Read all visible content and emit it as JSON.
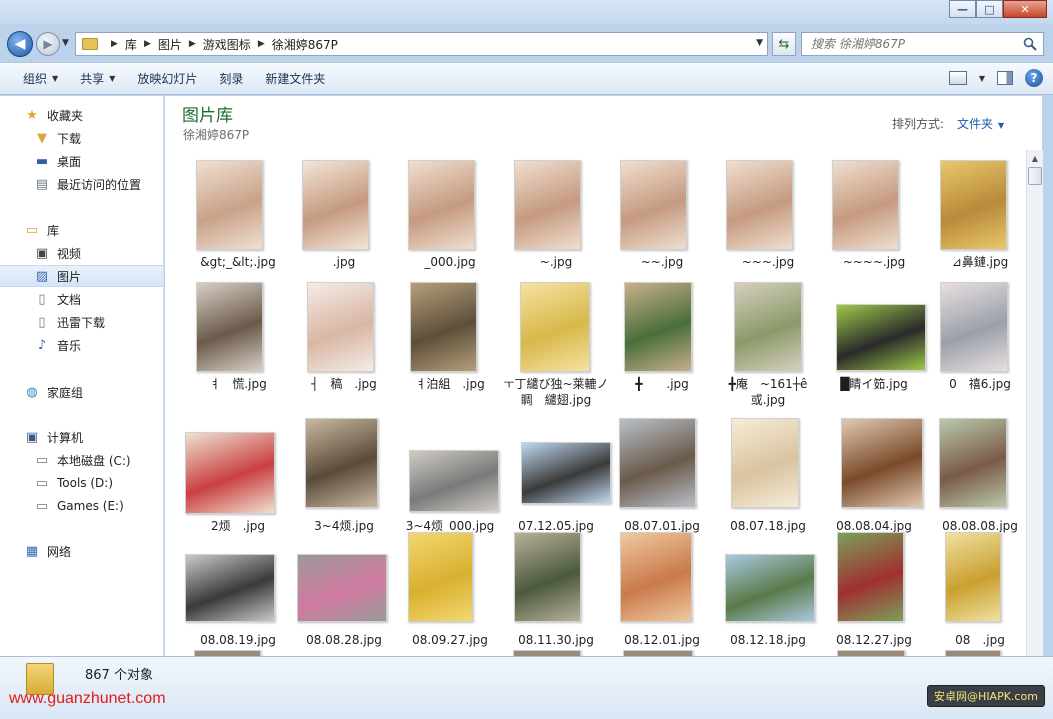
{
  "window": {
    "controls": [
      "—",
      "□",
      "✕"
    ]
  },
  "address": {
    "crumbs": [
      "库",
      "图片",
      "游戏图标",
      "徐湘婷867P"
    ]
  },
  "search": {
    "placeholder": "搜索 徐湘婷867P"
  },
  "toolbar": {
    "organize": "组织",
    "share": "共享",
    "slideshow": "放映幻灯片",
    "burn": "刻录",
    "new_folder": "新建文件夹"
  },
  "navpane": {
    "favorites": "收藏夹",
    "downloads": "下载",
    "desktop": "桌面",
    "recent": "最近访问的位置",
    "libraries": "库",
    "videos": "视频",
    "pictures": "图片",
    "documents": "文档",
    "xunlei": "迅雷下载",
    "music": "音乐",
    "homegroup": "家庭组",
    "computer": "计算机",
    "drive_c": "本地磁盘 (C:)",
    "drive_d": "Tools (D:)",
    "drive_e": "Games (E:)",
    "network": "网络"
  },
  "content": {
    "title": "图片库",
    "subtitle": "徐湘婷867P",
    "arrange_label": "排列方式:",
    "arrange_value": "文件夹"
  },
  "files": [
    {
      "name": "&gt;_&lt;.jpg",
      "colors": [
        "#c9a189",
        "#efe0d2"
      ]
    },
    {
      "name": ".jpg",
      "colors": [
        "#c59a80",
        "#f3e5d8"
      ]
    },
    {
      "name": "_000.jpg",
      "colors": [
        "#c59a80",
        "#efdfd0"
      ]
    },
    {
      "name": "~.jpg",
      "colors": [
        "#c59a80",
        "#efdfd0"
      ]
    },
    {
      "name": "~~.jpg",
      "colors": [
        "#c59a80",
        "#efdfd0"
      ]
    },
    {
      "name": "~~~.jpg",
      "colors": [
        "#c59a80",
        "#efdfd0"
      ]
    },
    {
      "name": "~~~~.jpg",
      "colors": [
        "#c59a80",
        "#efdfd0"
      ]
    },
    {
      "name": "⊿鼻鏈.jpg",
      "colors": [
        "#b88a3a",
        "#e9c86a"
      ]
    },
    {
      "name": "ㅕ　慌.jpg",
      "colors": [
        "#6b5a4a",
        "#d7cfc5"
      ]
    },
    {
      "name": "┤　稿　.jpg",
      "colors": [
        "#d9b6a3",
        "#f4ece6"
      ]
    },
    {
      "name": "ㅕ泊組　.jpg",
      "colors": [
        "#5d4f3b",
        "#b59f7a"
      ]
    },
    {
      "name": "ㅜ丁繾び独~莱轆ノ睭　繾翅.jpg",
      "colors": [
        "#d8b84a",
        "#f5e2a0"
      ]
    },
    {
      "name": "╋　　.jpg",
      "colors": [
        "#4a6e3a",
        "#c8b08a"
      ]
    },
    {
      "name": "╋庵　~161┼ê或.jpg",
      "colors": [
        "#8a9a6a",
        "#d7cfbf"
      ]
    },
    {
      "name": "█睛イ筎.jpg",
      "colors": [
        "#2a2a2a",
        "#9ec94a"
      ]
    },
    {
      "name": "0　禧6.jpg",
      "colors": [
        "#9aa0aa",
        "#e9dfe0"
      ]
    },
    {
      "name": "2烦　.jpg",
      "colors": [
        "#c94040",
        "#eee2d2"
      ]
    },
    {
      "name": "3~4烦.jpg",
      "colors": [
        "#5a4a3a",
        "#c9b9a0"
      ]
    },
    {
      "name": "3~4烦_000.jpg",
      "colors": [
        "#7a7a7a",
        "#d0ccc4"
      ]
    },
    {
      "name": "07.12.05.jpg",
      "colors": [
        "#3a3a3a",
        "#c0d9f0"
      ]
    },
    {
      "name": "08.07.01.jpg",
      "colors": [
        "#6a5a4a",
        "#b9c0c9"
      ]
    },
    {
      "name": "08.07.18.jpg",
      "colors": [
        "#d9c3a0",
        "#f6ecd8"
      ]
    },
    {
      "name": "08.08.04.jpg",
      "colors": [
        "#7a4a2a",
        "#e0c9b2"
      ]
    },
    {
      "name": "08.08.08.jpg",
      "colors": [
        "#7a5a4a",
        "#b9c9a9"
      ]
    },
    {
      "name": "08.08.19.jpg",
      "colors": [
        "#3a3a3a",
        "#c9c9c9"
      ]
    },
    {
      "name": "08.08.28.jpg",
      "colors": [
        "#d07aa0",
        "#9a9a9a"
      ]
    },
    {
      "name": "08.09.27.jpg",
      "colors": [
        "#d9b030",
        "#f2d870"
      ]
    },
    {
      "name": "08.11.30.jpg",
      "colors": [
        "#4a5a3a",
        "#b9b09a"
      ]
    },
    {
      "name": "08.12.01.jpg",
      "colors": [
        "#c97a4a",
        "#f0c9a0"
      ]
    },
    {
      "name": "08.12.18.jpg",
      "colors": [
        "#5a7a4a",
        "#a9c9e0"
      ]
    },
    {
      "name": "08.12.27.jpg",
      "colors": [
        "#a03030",
        "#7aa05a"
      ]
    },
    {
      "name": "08　.jpg",
      "colors": [
        "#c9a030",
        "#f0e0a0"
      ]
    }
  ],
  "status": {
    "count": "867 个对象",
    "watermark_left": "www.guanzhunet.com",
    "watermark_right": "安卓网@HIAPK.com"
  }
}
